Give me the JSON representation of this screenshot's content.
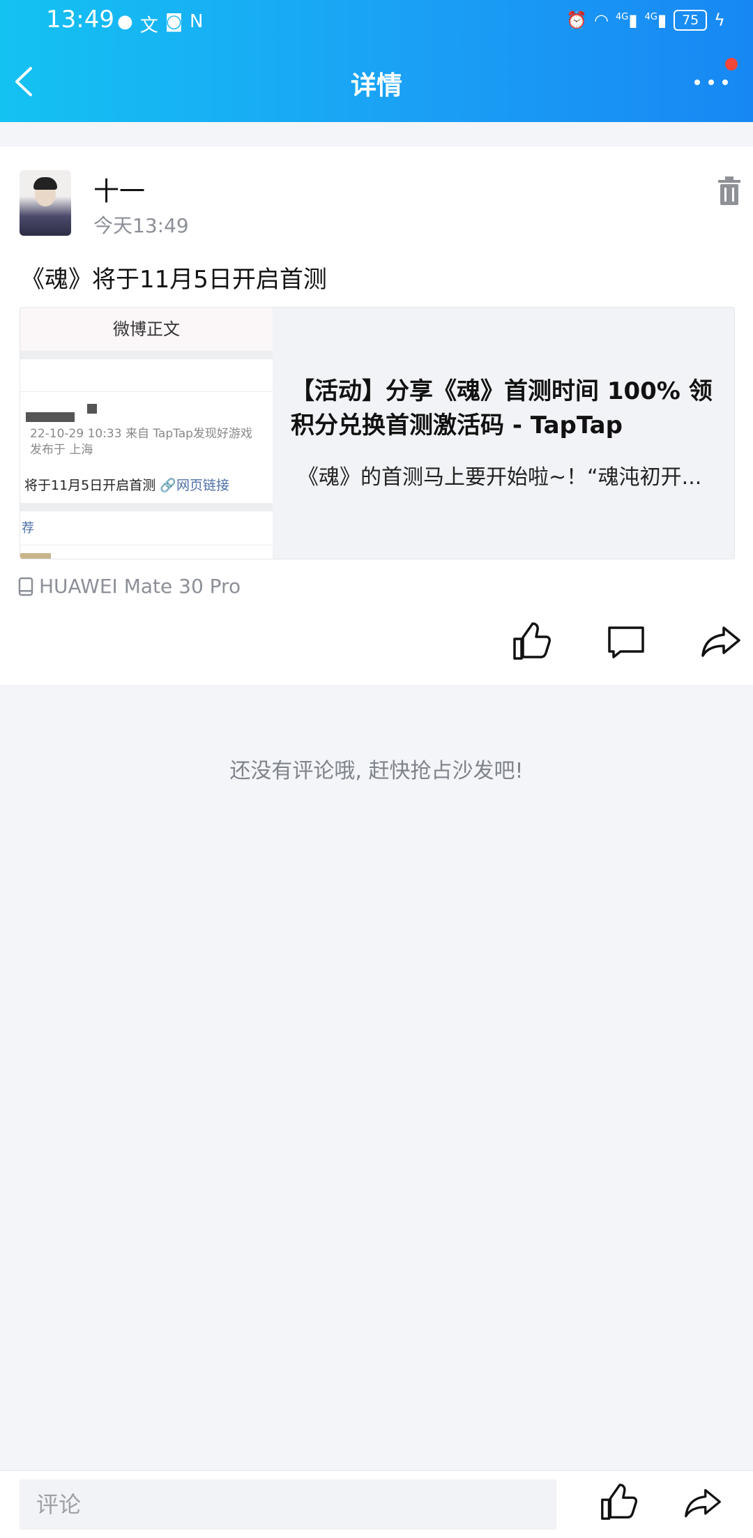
{
  "status_bar": {
    "time": "13:49",
    "battery": "75",
    "network_1": "4G",
    "network_2": "4G"
  },
  "header": {
    "title": "详情",
    "back_icon": "chevron-left-icon",
    "more_icon": "more-dots-icon"
  },
  "post": {
    "username": "十一",
    "time": "今天13:49",
    "text": "《魂》将于11月5日开启首测",
    "device": "HUAWEI Mate 30 Pro",
    "link_card": {
      "title": "【活动】分享《魂》首测时间 100% 领积分兑换首测激活码 - TapTap",
      "description": "《魂》的首测马上要开始啦~！“魂沌初开...",
      "thumbnail": {
        "header": "微博正文",
        "meta_line1": "22-10-29 10:33  来自 TapTap发现好游戏",
        "meta_line2": "发布于 上海",
        "text": "将于11月5日开启首测",
        "link": "🔗网页链接",
        "recommend": "荐"
      }
    }
  },
  "comments": {
    "empty_text": "还没有评论哦, 赶快抢占沙发吧!"
  },
  "bottom_bar": {
    "comment_placeholder": "评论"
  },
  "colors": {
    "header_start": "#14c2f2",
    "header_end": "#1788f3",
    "notification_dot": "#f4463a",
    "secondary_text": "#8c8f97"
  }
}
